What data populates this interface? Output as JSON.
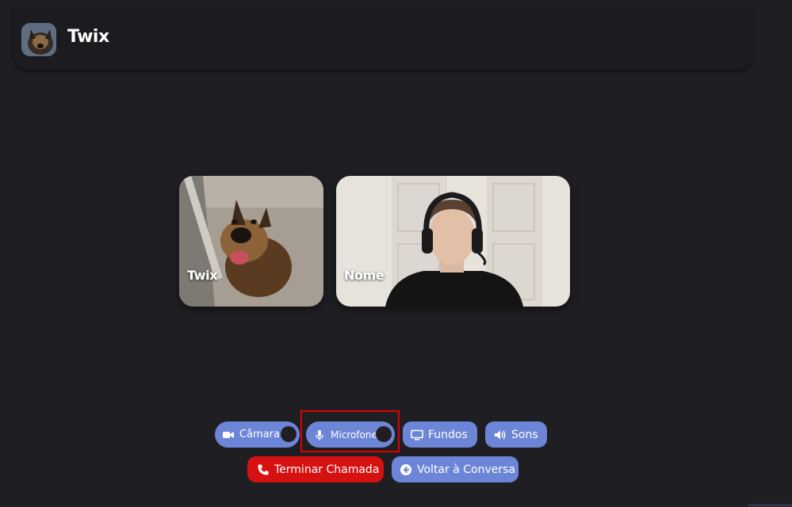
{
  "header": {
    "contact_name": "Twix",
    "avatar_icon": "dog-avatar"
  },
  "participants": [
    {
      "name": "Twix",
      "image": "dog-photo"
    },
    {
      "name": "Nome",
      "image": "person-with-headset-photo"
    }
  ],
  "controls": {
    "camera": {
      "label": "Câmara",
      "icon": "video-camera-icon",
      "toggle": "off"
    },
    "microphone": {
      "label": "Microfone",
      "icon": "microphone-icon",
      "toggle": "off"
    },
    "backgrounds": {
      "label": "Fundos",
      "icon": "monitor-icon"
    },
    "sounds": {
      "label": "Sons",
      "icon": "speaker-icon"
    },
    "end_call": {
      "label": "Terminar Chamada",
      "icon": "phone-icon"
    },
    "back": {
      "label": "Voltar à Conversa",
      "icon": "arrow-left-circle-icon"
    }
  },
  "colors": {
    "background": "#1f1f23",
    "button": "#6c85d6",
    "end_call": "#d61111",
    "highlight": "#e00000"
  }
}
